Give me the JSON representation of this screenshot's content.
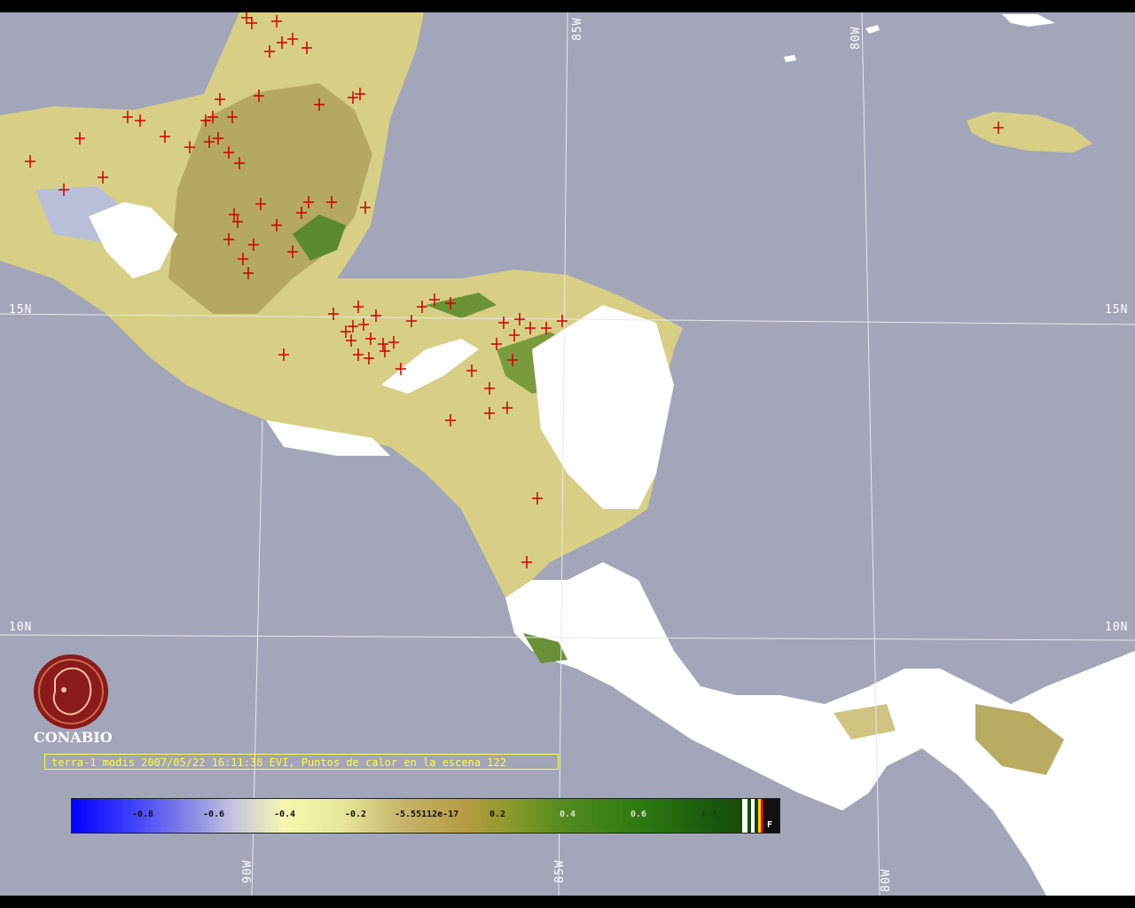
{
  "map": {
    "lon_labels": [
      {
        "id": "lon-85w-top",
        "text": "85W"
      },
      {
        "id": "lon-80w-top",
        "text": "80W"
      },
      {
        "id": "lon-90w-bottom",
        "text": "90W"
      },
      {
        "id": "lon-85w-bottom",
        "text": "85W"
      },
      {
        "id": "lon-80w-bottom",
        "text": "80W"
      }
    ],
    "lat_labels": [
      {
        "id": "lat-15n-left",
        "text": "15N"
      },
      {
        "id": "lat-15n-right",
        "text": "15N"
      },
      {
        "id": "lat-10n-left",
        "text": "10N"
      },
      {
        "id": "lat-10n-right",
        "text": "10N"
      }
    ],
    "colors": {
      "ocean": "#a2a6b8",
      "gridline": "#e8e8e8",
      "land_dry": "#d8d28c",
      "land_mid": "#b9ad6a",
      "land_green": "#4f8a2a",
      "cloud": "#ffffff",
      "hotspot": "#cc0000"
    }
  },
  "logo": {
    "name": "CONABIO",
    "label": "CONABIO",
    "color": "#8b1a1a"
  },
  "caption": {
    "text": "terra-1 modis 2007/05/22 16:11:38 EVI, Puntos de calor en la escena 122"
  },
  "colorbar": {
    "ticks": [
      "-0.8",
      "-0.6",
      "-0.4",
      "-0.2",
      "-5.55112e-17",
      "0.2",
      "0.4",
      "0.6",
      "0.8"
    ],
    "end_label": "F"
  }
}
